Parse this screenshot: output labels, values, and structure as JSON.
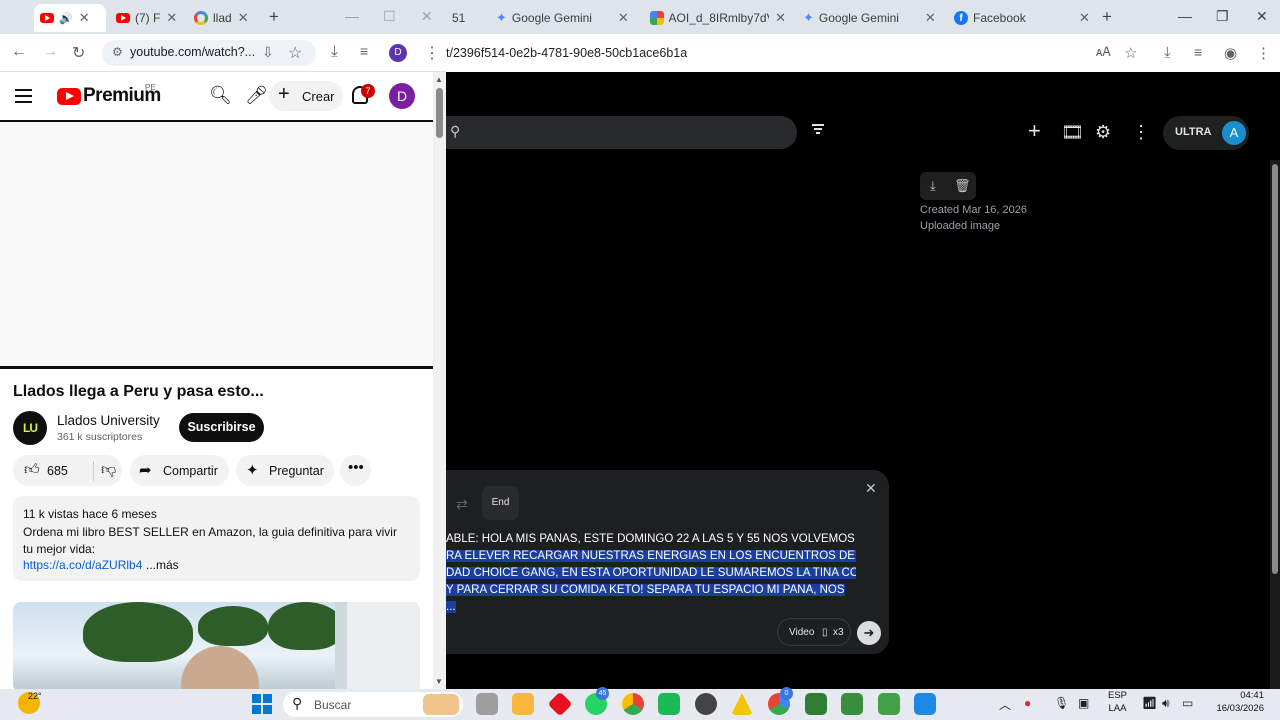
{
  "left_browser": {
    "tabs": [
      {
        "label": ""
      },
      {
        "label": "(7) F"
      },
      {
        "label": "llad"
      }
    ],
    "url": "youtube.com/watch?...",
    "profile_initial": "D"
  },
  "youtube": {
    "brand": "Premium",
    "region": "PE",
    "create_label": "Crear",
    "notification_count": "7",
    "avatar_initial": "D",
    "video_title": "Llados llega a Peru y pasa esto...",
    "channel_logo": "LU",
    "channel_name": "Llados University",
    "subscribers": "361 k suscriptores",
    "subscribe_label": "Suscribirse",
    "likes": "685",
    "share_label": "Compartir",
    "ask_label": "Preguntar",
    "views_date": "11 k vistas  hace 6 meses",
    "description": "Ordena mi libro BEST SELLER en Amazon, la guia definitiva para vivir tu mejor vida:",
    "link": "https://a.co/d/aZURlb4",
    "more_label": "...más"
  },
  "right_browser": {
    "tabs": [
      {
        "label": "51"
      },
      {
        "label": "Google Gemini"
      },
      {
        "label": "AOI_d_8IRmlby7dVx"
      },
      {
        "label": "Google Gemini"
      },
      {
        "label": "Facebook"
      }
    ],
    "url": "t/2396f514-0e2b-4781-90e8-50cb1ace6b1a"
  },
  "gemini": {
    "plan_label": "ULTRA",
    "avatar_initial": "A",
    "created": "Created Mar 16, 2026",
    "source": "Uploaded image",
    "end_label": "End",
    "transcript_lines": [
      "ABLE: HOLA MIS PANAS, ESTE DOMINGO 22 A LAS 5 Y 55 NOS VOLVEMOS A",
      "RA ELEVER RECARGAR NUESTRAS ENERGIAS EN LOS ENCUENTROS DE LA",
      "DAD CHOICE GANG, EN ESTA OPORTUNIDAD LE SUMAREMOS LA TINA CON",
      "Y PARA CERRAR SU COMIDA KETO! SEPARA TU ESPACIO MI PANA, NOS",
      "..."
    ],
    "video_label": "Video",
    "multiplier": "x3"
  },
  "taskbar": {
    "temperature": "22°",
    "search_placeholder": "Buscar",
    "whatsapp_badge": "45",
    "chrome_badge": "0",
    "lang_top": "ESP",
    "lang_bottom": "LAA",
    "time": "04:41",
    "date": "16/03/2026"
  },
  "colors": {
    "youtube_red": "#ff0000",
    "gemini_bg": "#000000",
    "selection": "#1a3f9e",
    "link_blue": "#065fd4"
  }
}
